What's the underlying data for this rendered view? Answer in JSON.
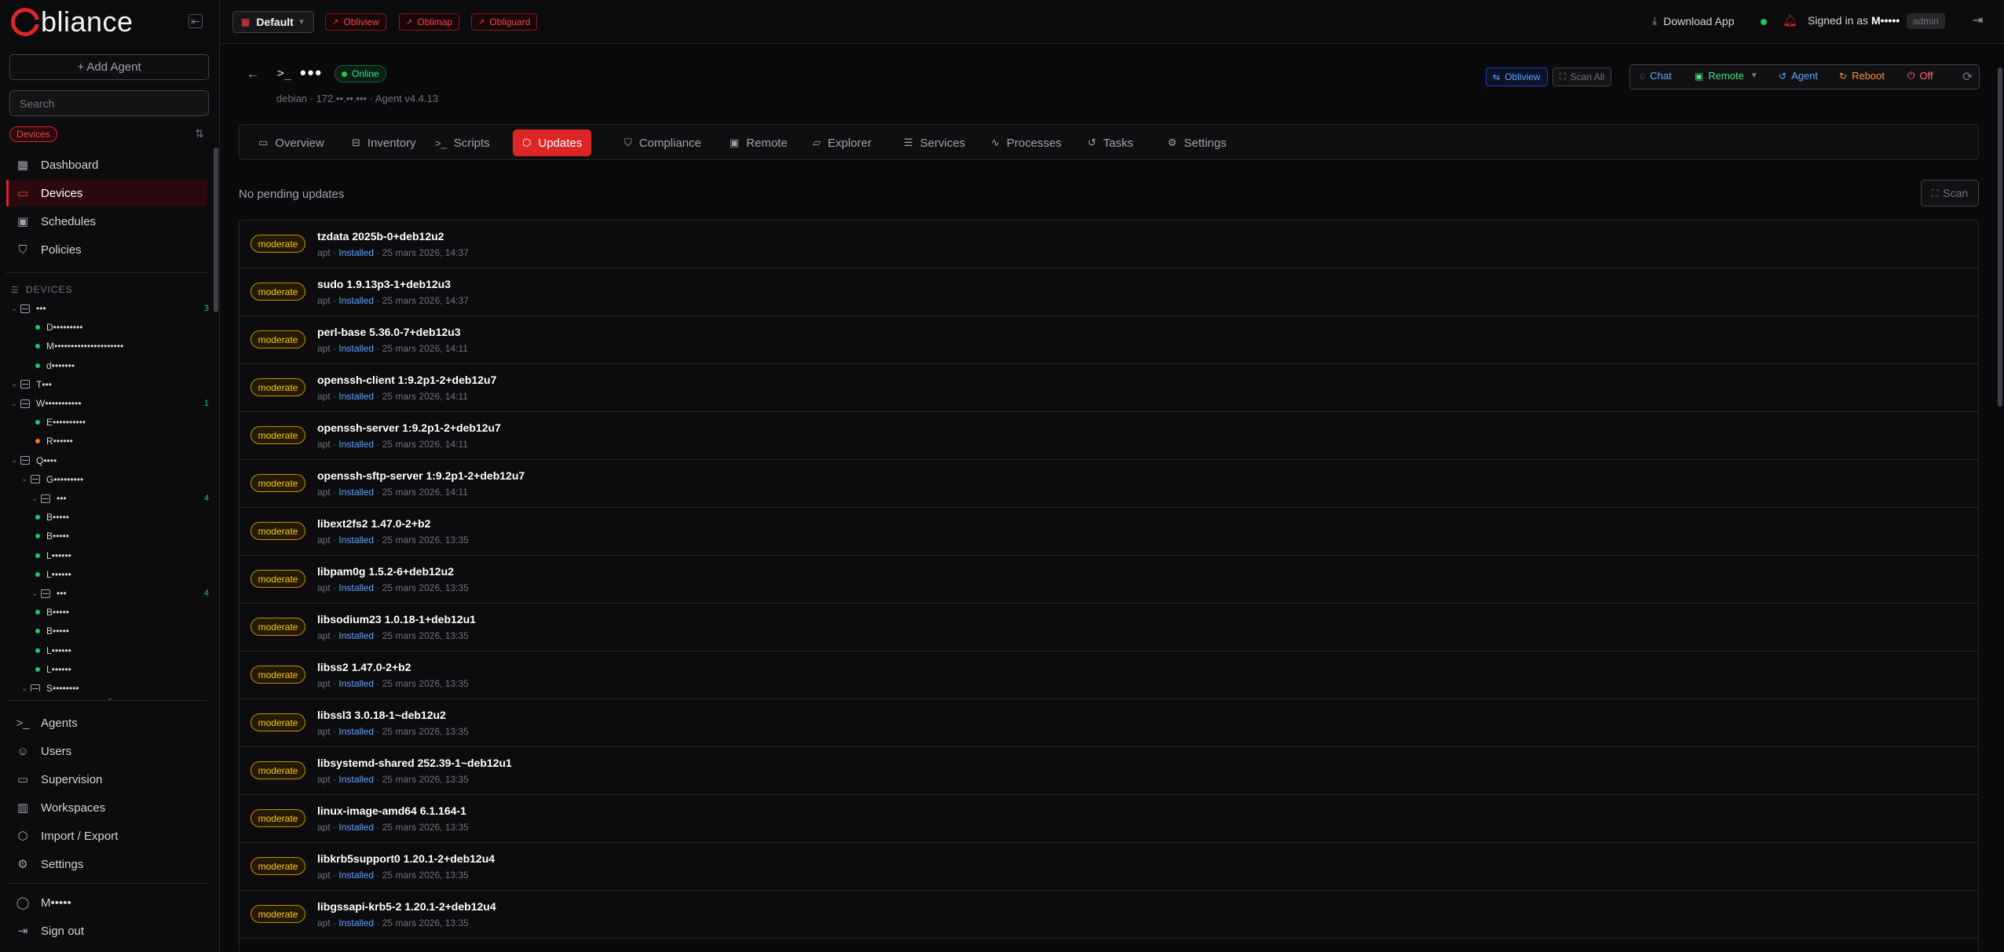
{
  "brand": {
    "logo_text": "bliance"
  },
  "sidebar": {
    "add_agent_label": "+ Add Agent",
    "search_placeholder": "Search",
    "filter_pill": "Devices",
    "nav_top": [
      {
        "label": "Dashboard",
        "icon": "dashboard-icon"
      },
      {
        "label": "Devices",
        "icon": "monitor-icon",
        "active": true
      },
      {
        "label": "Schedules",
        "icon": "calendar-icon"
      },
      {
        "label": "Policies",
        "icon": "shield-icon"
      }
    ],
    "tree_title": "DEVICES",
    "tree": [
      {
        "type": "group",
        "label": "•••",
        "level": 0,
        "count": "3"
      },
      {
        "type": "device",
        "label": "D•••••••••",
        "level": 1,
        "status": "#22c55e"
      },
      {
        "type": "device",
        "label": "M•••••••••••••••••••••",
        "level": 1,
        "status": "#22c55e"
      },
      {
        "type": "device",
        "label": "d•••••••",
        "level": 1,
        "status": "#22c55e"
      },
      {
        "type": "group",
        "label": "T•••",
        "level": 0,
        "count": ""
      },
      {
        "type": "group",
        "label": "W•••••••••••",
        "level": 0,
        "count": "1"
      },
      {
        "type": "device",
        "label": "E••••••••••",
        "level": 1,
        "status": "#22c55e"
      },
      {
        "type": "device",
        "label": "R••••••",
        "level": 1,
        "status": "#f97316"
      },
      {
        "type": "group",
        "label": "Q••••",
        "level": 0,
        "count": ""
      },
      {
        "type": "group",
        "label": "G•••••••••",
        "level": 1,
        "count": ""
      },
      {
        "type": "group",
        "label": "•••",
        "level": 2,
        "count": "4"
      },
      {
        "type": "device",
        "label": "B•••••",
        "level": 1,
        "status": "#22c55e"
      },
      {
        "type": "device",
        "label": "B•••••",
        "level": 1,
        "status": "#22c55e"
      },
      {
        "type": "device",
        "label": "L••••••",
        "level": 1,
        "status": "#22c55e"
      },
      {
        "type": "device",
        "label": "L••••••",
        "level": 1,
        "status": "#22c55e"
      },
      {
        "type": "group",
        "label": "•••",
        "level": 2,
        "count": "4"
      },
      {
        "type": "device",
        "label": "B•••••",
        "level": 1,
        "status": "#22c55e"
      },
      {
        "type": "device",
        "label": "B•••••",
        "level": 1,
        "status": "#22c55e"
      },
      {
        "type": "device",
        "label": "L••••••",
        "level": 1,
        "status": "#22c55e"
      },
      {
        "type": "device",
        "label": "L••••••",
        "level": 1,
        "status": "#22c55e"
      },
      {
        "type": "group",
        "label": "S••••••••",
        "level": 1,
        "count": ""
      }
    ],
    "nav_bottom": [
      {
        "label": "Agents",
        "icon": "terminal-icon"
      },
      {
        "label": "Users",
        "icon": "users-icon"
      },
      {
        "label": "Supervision",
        "icon": "laptop-icon"
      },
      {
        "label": "Workspaces",
        "icon": "building-icon"
      },
      {
        "label": "Import / Export",
        "icon": "package-icon"
      },
      {
        "label": "Settings",
        "icon": "gear-icon"
      }
    ],
    "nav_user": [
      {
        "label": "M•••••",
        "icon": "user-icon"
      },
      {
        "label": "Sign out",
        "icon": "logout-icon"
      }
    ]
  },
  "header": {
    "workspace": "Default",
    "apps": [
      "Obliview",
      "Oblimap",
      "Obliguard"
    ],
    "download_label": "Download App",
    "signed_in_prefix": "Signed in as",
    "signed_in_user": "M•••••",
    "role": "admin"
  },
  "device": {
    "name": "•••",
    "status": "Online",
    "subtitle": "debian · 172.••.••.••• · Agent v4.4.13"
  },
  "actions": {
    "obliview": "Obliview",
    "scan_all": "Scan All",
    "chat": "Chat",
    "remote": "Remote",
    "agent": "Agent",
    "reboot": "Reboot",
    "off": "Off"
  },
  "tabs": [
    {
      "label": "Overview",
      "icon": "monitor-icon"
    },
    {
      "label": "Inventory",
      "icon": "hdd-icon"
    },
    {
      "label": "Scripts",
      "icon": "terminal-icon"
    },
    {
      "label": "Updates",
      "icon": "package-icon",
      "active": true
    },
    {
      "label": "Compliance",
      "icon": "shield-check-icon"
    },
    {
      "label": "Remote",
      "icon": "remote-icon"
    },
    {
      "label": "Explorer",
      "icon": "folder-icon"
    },
    {
      "label": "Services",
      "icon": "server-icon"
    },
    {
      "label": "Processes",
      "icon": "activity-icon"
    },
    {
      "label": "Tasks",
      "icon": "history-icon"
    },
    {
      "label": "Settings",
      "icon": "gear-icon"
    }
  ],
  "updates": {
    "pending_text": "No pending updates",
    "scan_label": "Scan",
    "items": [
      {
        "severity": "moderate",
        "name": "tzdata 2025b-0+deb12u2",
        "source": "apt",
        "status": "Installed",
        "date": "25 mars 2026, 14:37"
      },
      {
        "severity": "moderate",
        "name": "sudo 1.9.13p3-1+deb12u3",
        "source": "apt",
        "status": "Installed",
        "date": "25 mars 2026, 14:37"
      },
      {
        "severity": "moderate",
        "name": "perl-base 5.36.0-7+deb12u3",
        "source": "apt",
        "status": "Installed",
        "date": "25 mars 2026, 14:11"
      },
      {
        "severity": "moderate",
        "name": "openssh-client 1:9.2p1-2+deb12u7",
        "source": "apt",
        "status": "Installed",
        "date": "25 mars 2026, 14:11"
      },
      {
        "severity": "moderate",
        "name": "openssh-server 1:9.2p1-2+deb12u7",
        "source": "apt",
        "status": "Installed",
        "date": "25 mars 2026, 14:11"
      },
      {
        "severity": "moderate",
        "name": "openssh-sftp-server 1:9.2p1-2+deb12u7",
        "source": "apt",
        "status": "Installed",
        "date": "25 mars 2026, 14:11"
      },
      {
        "severity": "moderate",
        "name": "libext2fs2 1.47.0-2+b2",
        "source": "apt",
        "status": "Installed",
        "date": "25 mars 2026, 13:35"
      },
      {
        "severity": "moderate",
        "name": "libpam0g 1.5.2-6+deb12u2",
        "source": "apt",
        "status": "Installed",
        "date": "25 mars 2026, 13:35"
      },
      {
        "severity": "moderate",
        "name": "libsodium23 1.0.18-1+deb12u1",
        "source": "apt",
        "status": "Installed",
        "date": "25 mars 2026, 13:35"
      },
      {
        "severity": "moderate",
        "name": "libss2 1.47.0-2+b2",
        "source": "apt",
        "status": "Installed",
        "date": "25 mars 2026, 13:35"
      },
      {
        "severity": "moderate",
        "name": "libssl3 3.0.18-1~deb12u2",
        "source": "apt",
        "status": "Installed",
        "date": "25 mars 2026, 13:35"
      },
      {
        "severity": "moderate",
        "name": "libsystemd-shared 252.39-1~deb12u1",
        "source": "apt",
        "status": "Installed",
        "date": "25 mars 2026, 13:35"
      },
      {
        "severity": "moderate",
        "name": "linux-image-amd64 6.1.164-1",
        "source": "apt",
        "status": "Installed",
        "date": "25 mars 2026, 13:35"
      },
      {
        "severity": "moderate",
        "name": "libkrb5support0 1.20.1-2+deb12u4",
        "source": "apt",
        "status": "Installed",
        "date": "25 mars 2026, 13:35"
      },
      {
        "severity": "moderate",
        "name": "libgssapi-krb5-2 1.20.1-2+deb12u4",
        "source": "apt",
        "status": "Installed",
        "date": "25 mars 2026, 13:35"
      }
    ]
  }
}
